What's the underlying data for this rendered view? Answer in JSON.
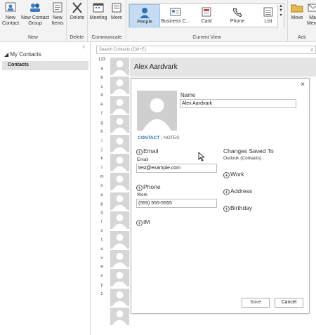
{
  "ribbon": {
    "new_group": {
      "title": "New",
      "new_contact": "New Contact",
      "new_contact_group": "New Contact Group",
      "new_items": "New Items"
    },
    "delete_group": {
      "title": "Delete",
      "delete": "Delete"
    },
    "communicate_group": {
      "title": "Communicate",
      "meeting": "Meeting",
      "more": "More"
    },
    "current_view": {
      "title": "Current View",
      "views": [
        "People",
        "Business C...",
        "Card",
        "Phone",
        "List"
      ],
      "selected": "People"
    },
    "actions_group": {
      "title": "Acti",
      "move": "Move",
      "mail_merge": "Ma Merg"
    }
  },
  "nav": {
    "header": "◢ My Contacts",
    "item": "Contacts"
  },
  "search": {
    "placeholder": "Search Contacts (Ctrl+E)"
  },
  "letters": [
    "123",
    "a",
    "b",
    "c",
    "d",
    "e",
    "f",
    "g",
    "h",
    "i",
    "j",
    "k",
    "l",
    "m",
    "n",
    "o",
    "p",
    "q",
    "r",
    "s",
    "t",
    "u",
    "v",
    "w",
    "x",
    "y",
    "z"
  ],
  "contact_header": {
    "name": "Alex Aardvark"
  },
  "dialog": {
    "close": "×",
    "name_label": "Name",
    "name_value": "Alex Aardvark",
    "tabs": {
      "contact": "CONTACT",
      "separator": "|",
      "notes": "NOTES"
    },
    "email": {
      "header": "Email",
      "label": "Email",
      "value": "test@example.com"
    },
    "phone": {
      "header": "Phone",
      "label": "Work",
      "value": "(555) 555-5555"
    },
    "im": {
      "header": "IM"
    },
    "saved_to": {
      "title": "Changes Saved To",
      "location": "Outlook (Contacts)"
    },
    "work": "Work",
    "address": "Address",
    "birthday": "Birthday",
    "save": "Save",
    "cancel": "Cancel"
  },
  "colors": {
    "accent": "#2a72b5",
    "selected_view": "#c5dcf3"
  }
}
